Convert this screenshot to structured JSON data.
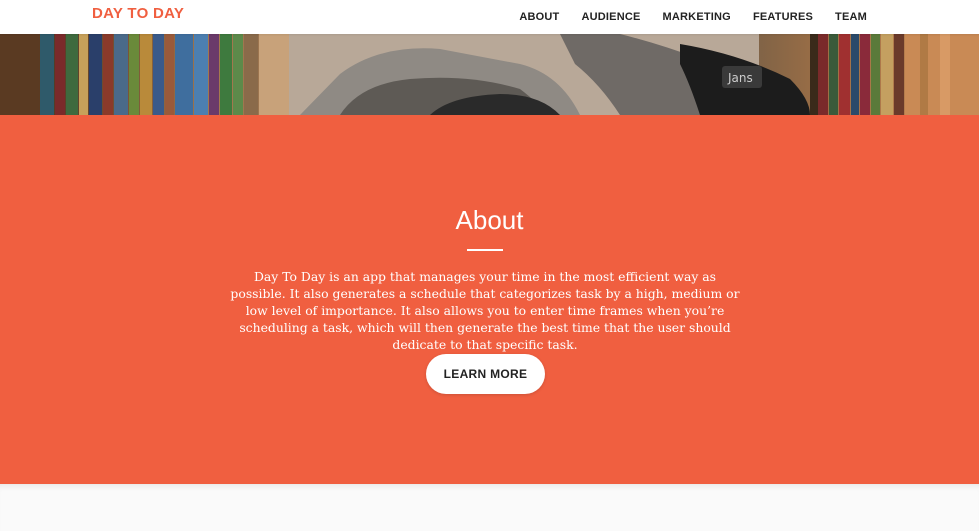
{
  "colors": {
    "accent": "#f05f40",
    "nav_text": "#222222",
    "white": "#ffffff"
  },
  "nav": {
    "brand": "DAY TO DAY",
    "links": [
      "ABOUT",
      "AUDIENCE",
      "MARKETING",
      "FEATURES",
      "TEAM"
    ]
  },
  "about": {
    "title": "About",
    "text": "Day To Day is an app that manages your time in the most efficient way as possible. It also generates a schedule that categorizes task by a high, medium or low level of importance. It also allows you to enter time frames when you’re scheduling a task, which will then generate the best time that the user should dedicate to that specific task.",
    "button_label": "LEARN MORE"
  }
}
